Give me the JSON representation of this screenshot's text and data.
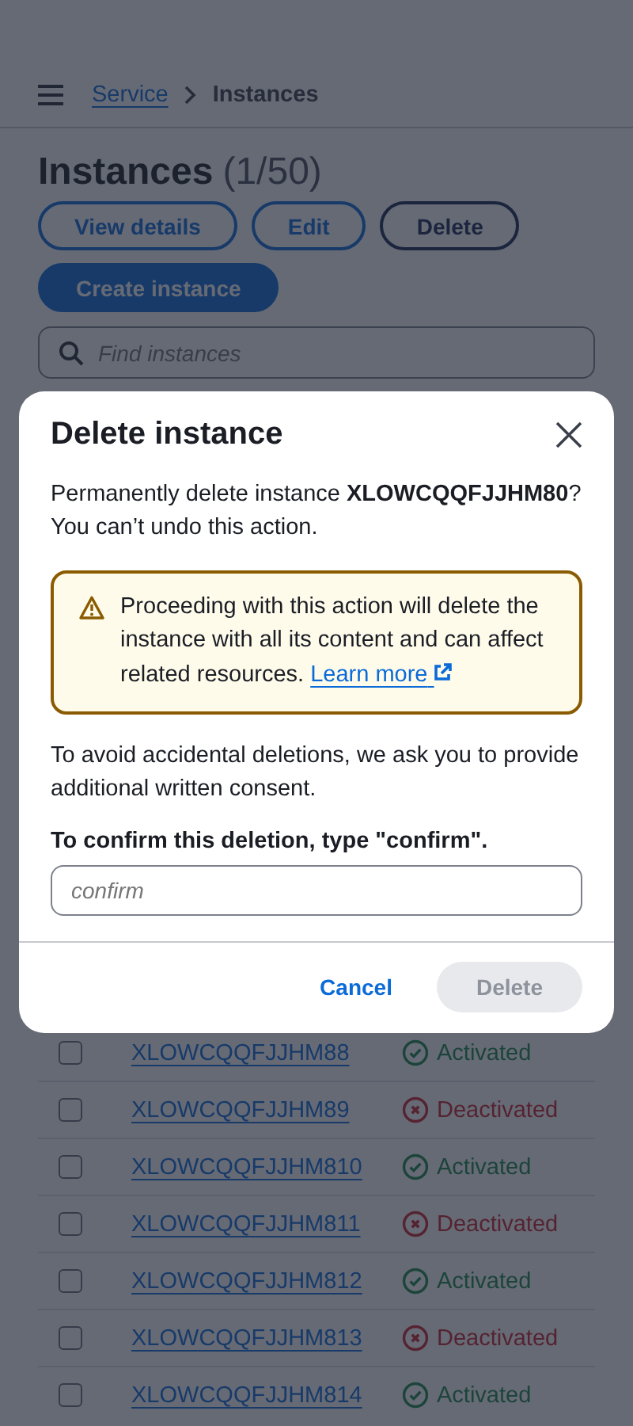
{
  "header": {
    "breadcrumbs": [
      {
        "label": "Service",
        "kind": "link"
      },
      {
        "label": "Instances",
        "kind": "current"
      }
    ]
  },
  "page": {
    "title": "Instances",
    "count": "(1/50)",
    "actions": [
      {
        "label": "View details",
        "kind": "normal"
      },
      {
        "label": "Edit",
        "kind": "normal"
      },
      {
        "label": "Delete",
        "kind": "strong"
      },
      {
        "label": "Create instance",
        "kind": "primary"
      }
    ],
    "search": {
      "placeholder": "Find instances"
    }
  },
  "table": {
    "rows": [
      {
        "name": "XLOWCQQFJJHM88",
        "checked": false,
        "status": "Activated",
        "kind": "activated"
      },
      {
        "name": "XLOWCQQFJJHM89",
        "checked": false,
        "status": "Deactivated",
        "kind": "deactivated"
      },
      {
        "name": "XLOWCQQFJJHM810",
        "checked": false,
        "status": "Activated",
        "kind": "activated"
      },
      {
        "name": "XLOWCQQFJJHM811",
        "checked": false,
        "status": "Deactivated",
        "kind": "deactivated"
      },
      {
        "name": "XLOWCQQFJJHM812",
        "checked": false,
        "status": "Activated",
        "kind": "activated"
      },
      {
        "name": "XLOWCQQFJJHM813",
        "checked": false,
        "status": "Deactivated",
        "kind": "deactivated"
      },
      {
        "name": "XLOWCQQFJJHM814",
        "checked": false,
        "status": "Activated",
        "kind": "activated"
      }
    ]
  },
  "modal": {
    "title": "Delete instance",
    "message": "Permanently delete instance **XLOWCQQFJJHM80**? You can’t undo this action.",
    "warning": {
      "text": "Proceeding with this action will delete the instance with all its content and can affect related resources.",
      "link": "Learn more"
    },
    "consent": "To avoid accidental deletions, we ask you to provide additional written consent.",
    "field": {
      "label": "To confirm this deletion, type \"confirm\".",
      "placeholder": "confirm"
    },
    "buttons": [
      {
        "label": "Cancel",
        "kind": "link",
        "disabled": false
      },
      {
        "label": "Delete",
        "kind": "filled",
        "disabled": true
      }
    ]
  }
}
